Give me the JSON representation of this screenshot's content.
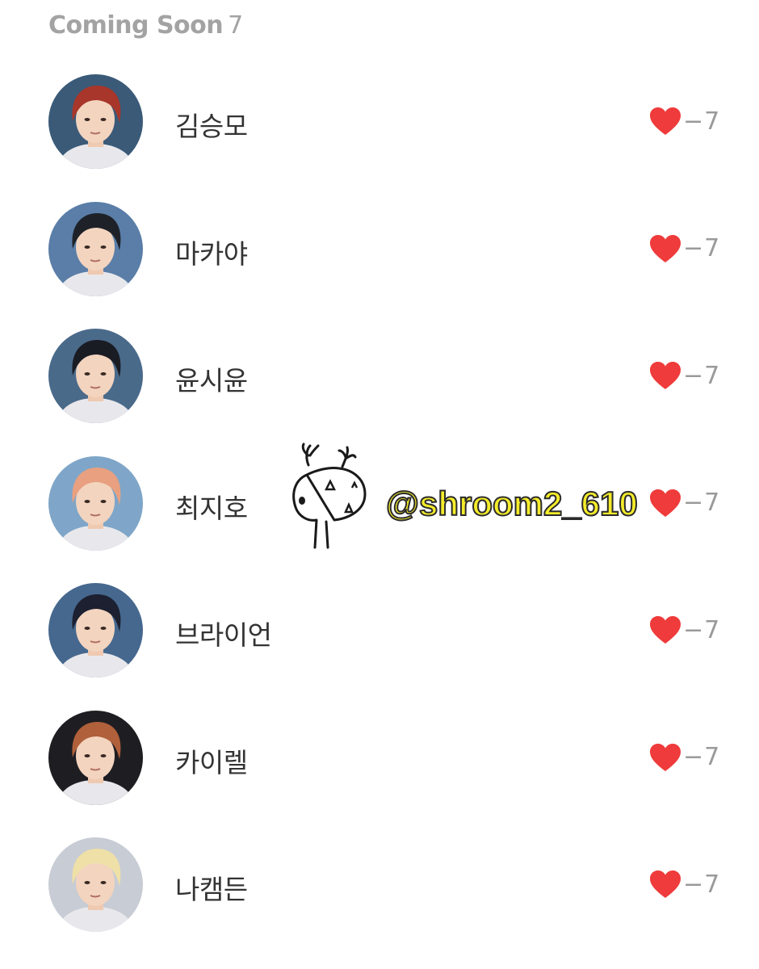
{
  "header": {
    "title": "Coming Soon",
    "count": "7"
  },
  "members": [
    {
      "name": "김승모",
      "likes": "−7",
      "hair": "#a8362a",
      "bg": "#3a5a78"
    },
    {
      "name": "마카야",
      "likes": "−7",
      "hair": "#1e2228",
      "bg": "#5a7ea8"
    },
    {
      "name": "윤시윤",
      "likes": "−7",
      "hair": "#1a1c24",
      "bg": "#4a6a8a"
    },
    {
      "name": "최지호",
      "likes": "−7",
      "hair": "#e8a080",
      "bg": "#7fa6c8"
    },
    {
      "name": "브라이언",
      "likes": "−7",
      "hair": "#1c2030",
      "bg": "#46688e"
    },
    {
      "name": "카이렐",
      "likes": "−7",
      "hair": "#b0603a",
      "bg": "#1e1e22"
    },
    {
      "name": "나캠든",
      "likes": "−7",
      "hair": "#efe0a8",
      "bg": "#c8ccd4"
    }
  ],
  "icons": {
    "like": "heart-icon",
    "avatar": "profile-photo"
  },
  "colors": {
    "heart": "#ef3b3b",
    "header_text": "#a3a3a3",
    "name_text": "#333333",
    "count_text": "#9a9a9a",
    "watermark_fill": "#f5ec2a"
  },
  "watermark": {
    "handle": "@shroom2_610"
  }
}
